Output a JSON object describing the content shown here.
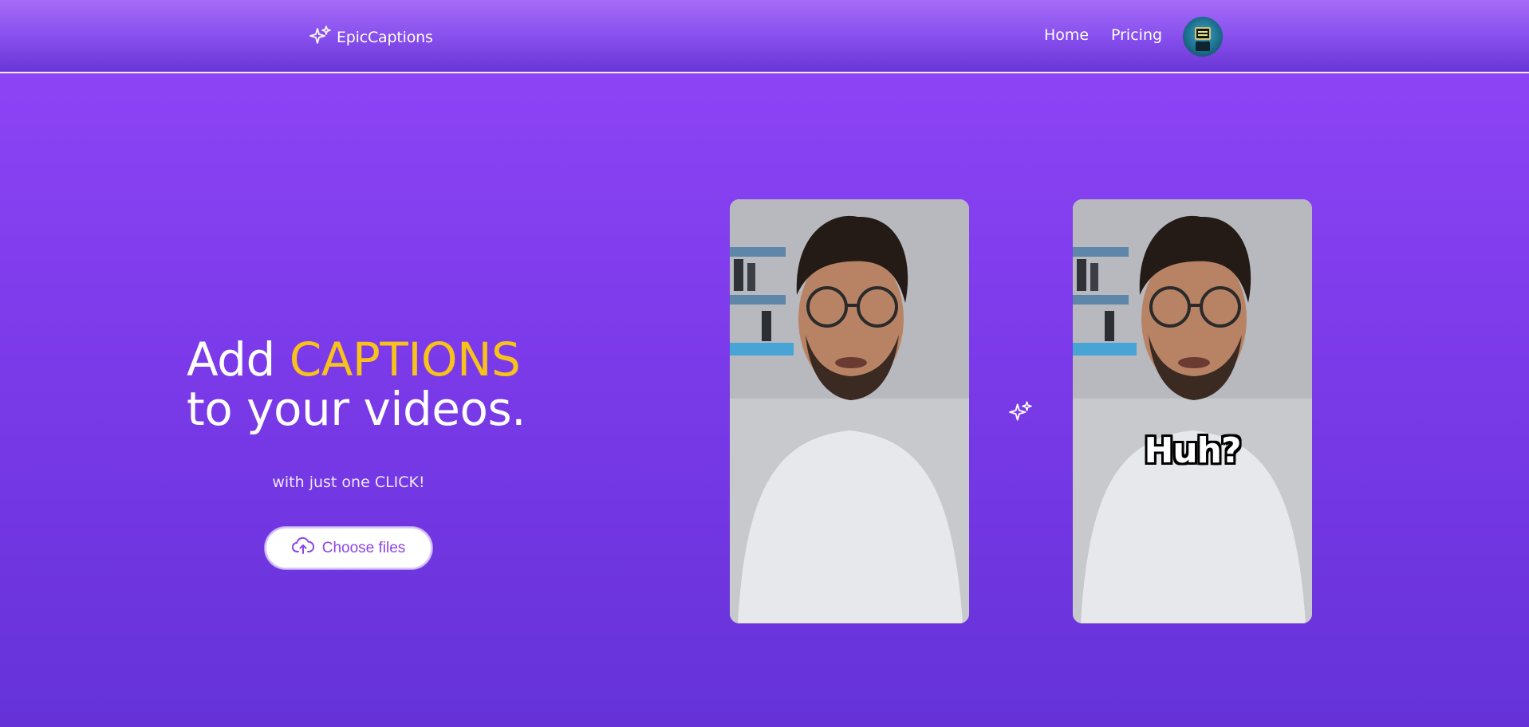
{
  "nav": {
    "brand": "EpicCaptions",
    "links": [
      {
        "label": "Home"
      },
      {
        "label": "Pricing"
      }
    ]
  },
  "hero": {
    "title_prefix": "Add ",
    "title_accent": "CAPTIONS",
    "title_line2": "to your videos.",
    "subtitle": "with just one CLICK!",
    "upload_label": "Choose files"
  },
  "preview": {
    "caption_text": "Huh?"
  },
  "colors": {
    "accent": "#f7c21a",
    "button_text": "#8b45e6",
    "background_top": "#9146f8",
    "background_bottom": "#6532d8"
  },
  "icons": {
    "logo": "sparkles-icon",
    "upload": "cloud-upload-icon",
    "transform": "sparkles-icon"
  }
}
